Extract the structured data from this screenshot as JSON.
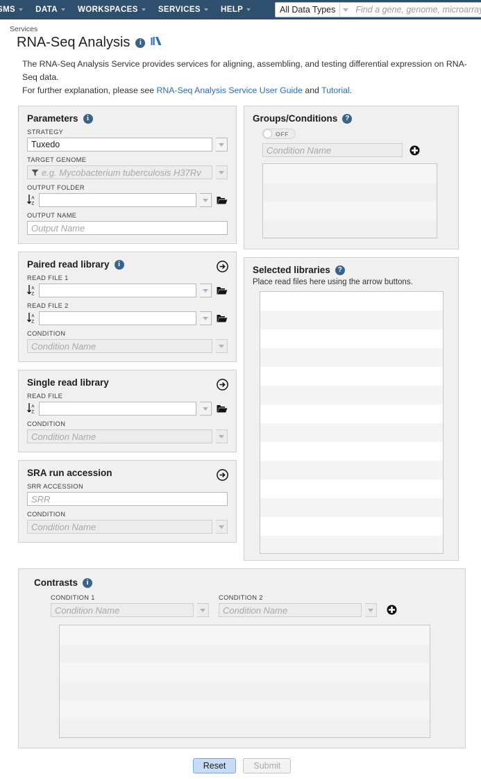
{
  "nav": {
    "items": [
      {
        "label": "SMS",
        "caret": true
      },
      {
        "label": "DATA",
        "caret": true
      },
      {
        "label": "WORKSPACES",
        "caret": true
      },
      {
        "label": "SERVICES",
        "caret": true
      },
      {
        "label": "HELP",
        "caret": true
      }
    ],
    "search": {
      "data_type": "All Data Types",
      "placeholder": "Find a gene, genome, microarray, e"
    }
  },
  "header": {
    "breadcrumb": "Services",
    "title": "RNA-Seq Analysis",
    "info_icon": "info-icon",
    "book_icon": "book-icon"
  },
  "description": {
    "line1": "The RNA-Seq Analysis Service provides services for aligning, assembling, and testing differential expression on RNA-Seq data.",
    "line2_prefix": "For further explanation, please see ",
    "link1": "RNA-Seq Analysis Service User Guide",
    "line2_mid": " and ",
    "link2": "Tutorial",
    "line2_suffix": "."
  },
  "parameters": {
    "title": "Parameters",
    "strategy_label": "STRATEGY",
    "strategy_value": "Tuxedo",
    "target_genome_label": "TARGET GENOME",
    "target_genome_placeholder": "e.g. Mycobacterium tuberculosis H37Rv",
    "output_folder_label": "OUTPUT FOLDER",
    "output_folder_value": "",
    "output_name_label": "OUTPUT NAME",
    "output_name_placeholder": "Output Name"
  },
  "groups": {
    "title": "Groups/Conditions",
    "toggle_label": "OFF",
    "toggle_state": "off",
    "condition_placeholder": "Condition Name",
    "add_label": "add-condition"
  },
  "paired": {
    "title": "Paired read library",
    "read_file_1_label": "READ FILE 1",
    "read_file_1_value": "",
    "read_file_2_label": "READ FILE 2",
    "read_file_2_value": "",
    "condition_label": "CONDITION",
    "condition_placeholder": "Condition Name"
  },
  "single": {
    "title": "Single read library",
    "read_file_label": "READ FILE",
    "read_file_value": "",
    "condition_label": "CONDITION",
    "condition_placeholder": "Condition Name"
  },
  "sra": {
    "title": "SRA run accession",
    "accession_label": "SRR ACCESSION",
    "accession_placeholder": "SRR",
    "condition_label": "CONDITION",
    "condition_placeholder": "Condition Name"
  },
  "selected_libraries": {
    "title": "Selected libraries",
    "note": "Place read files here using the arrow buttons.",
    "items": []
  },
  "contrasts": {
    "title": "Contrasts",
    "condition1_label": "CONDITION 1",
    "condition1_placeholder": "Condition Name",
    "condition2_label": "CONDITION 2",
    "condition2_placeholder": "Condition Name",
    "items": []
  },
  "actions": {
    "reset_label": "Reset",
    "submit_label": "Submit"
  },
  "colors": {
    "navbar": "#2f4f6f",
    "link": "#2a6ebb",
    "panel_bg": "#f0f0f0",
    "accent_icon": "#3a6389",
    "primary_button": "#c7ddf5"
  }
}
